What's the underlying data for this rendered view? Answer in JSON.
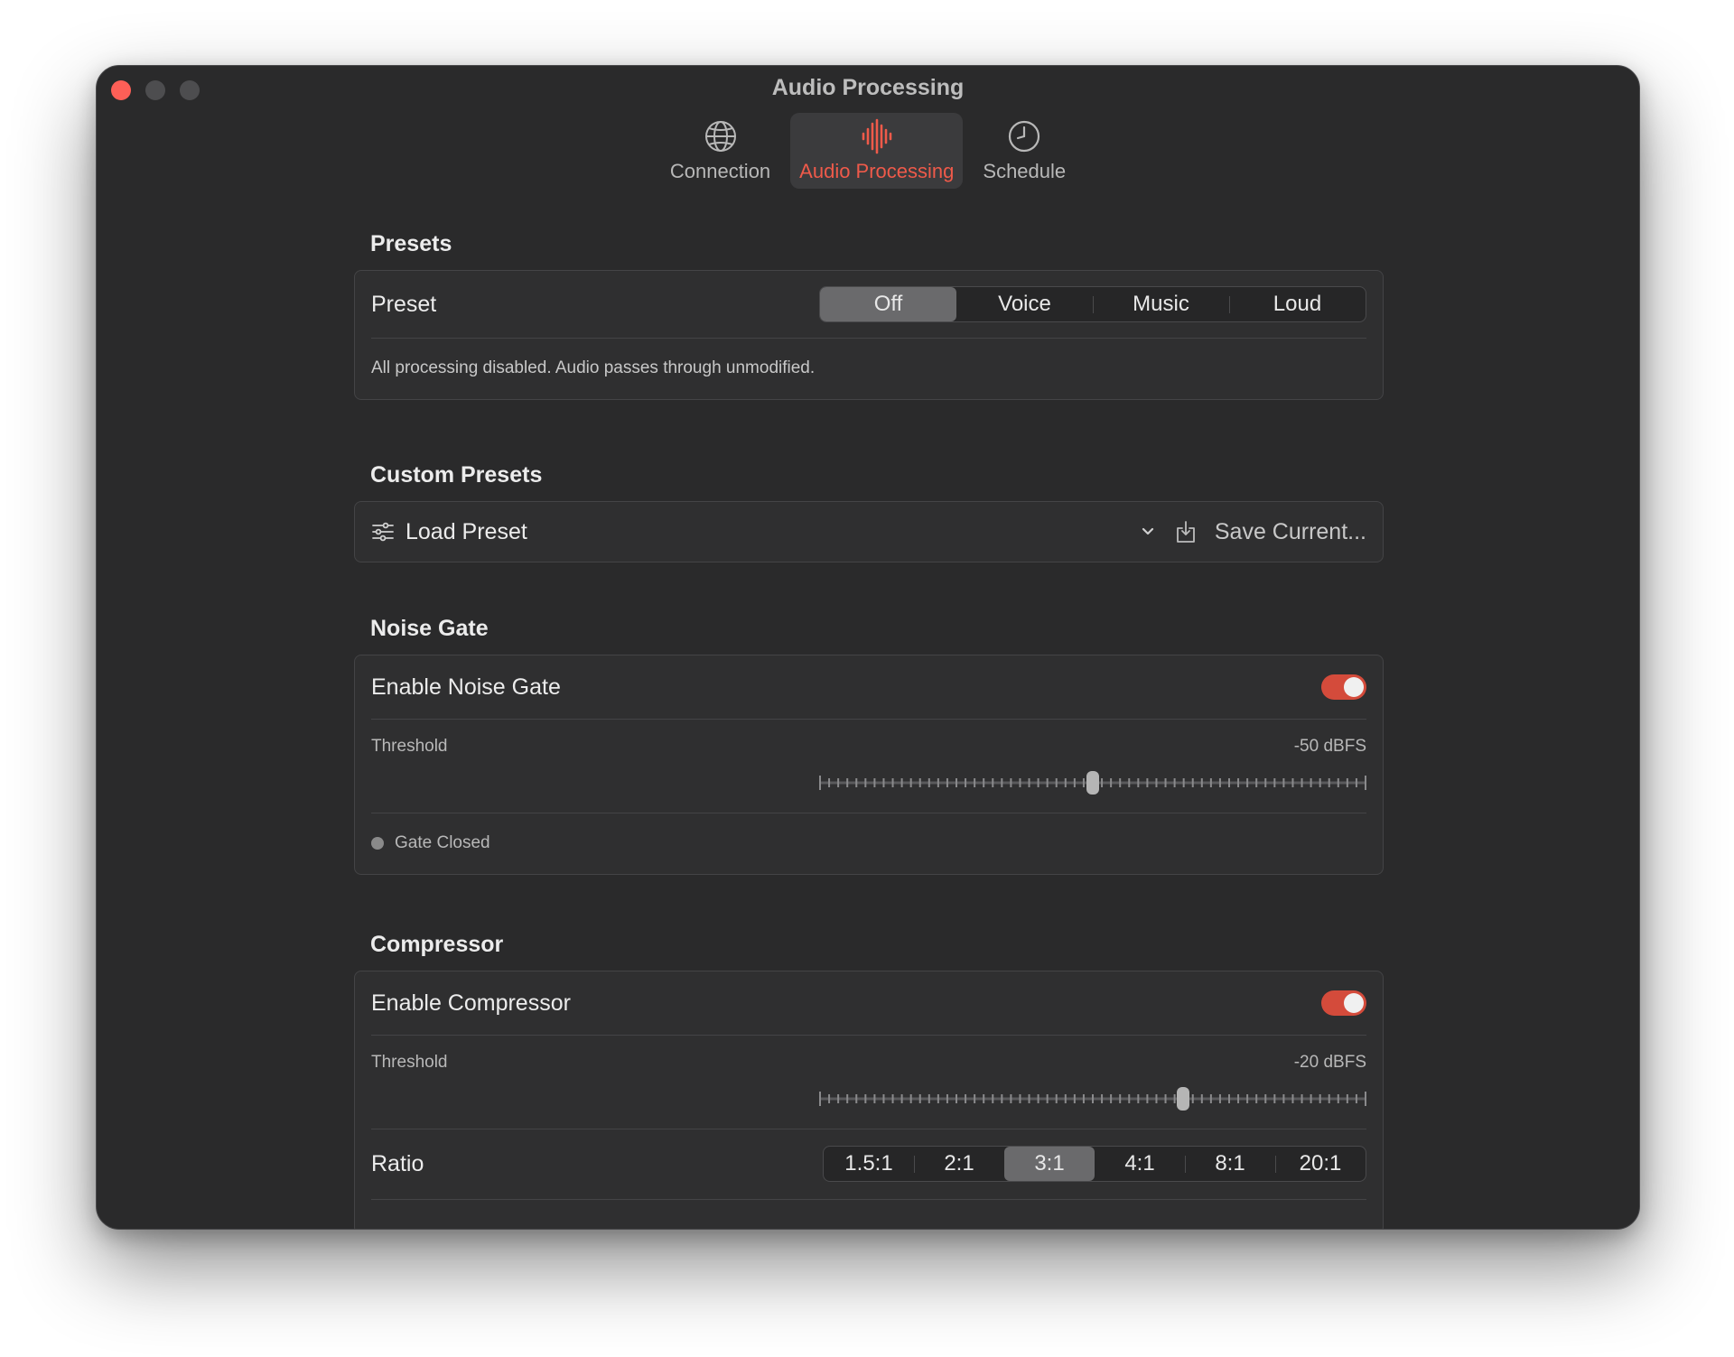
{
  "window": {
    "title": "Audio Processing"
  },
  "toolbar": {
    "tabs": [
      {
        "label": "Connection",
        "icon": "globe-icon",
        "active": false
      },
      {
        "label": "Audio Processing",
        "icon": "waveform-icon",
        "active": true
      },
      {
        "label": "Schedule",
        "icon": "clock-icon",
        "active": false
      }
    ]
  },
  "colors": {
    "accent": "#ef5a4a",
    "toggle_on": "#d44b3b",
    "window_bg": "#2a2a2b"
  },
  "presets": {
    "section_title": "Presets",
    "row_label": "Preset",
    "options": [
      "Off",
      "Voice",
      "Music",
      "Loud"
    ],
    "selected": "Off",
    "description": "All processing disabled. Audio passes through unmodified."
  },
  "custom_presets": {
    "section_title": "Custom Presets",
    "load_label": "Load Preset",
    "save_label": "Save Current..."
  },
  "noise_gate": {
    "section_title": "Noise Gate",
    "enable_label": "Enable Noise Gate",
    "enabled": true,
    "threshold_label": "Threshold",
    "threshold_value": "-50 dBFS",
    "threshold_fraction": 0.5,
    "status": "Gate Closed"
  },
  "compressor": {
    "section_title": "Compressor",
    "enable_label": "Enable Compressor",
    "enabled": true,
    "threshold_label": "Threshold",
    "threshold_value": "-20 dBFS",
    "threshold_fraction": 0.665,
    "ratio_label": "Ratio",
    "ratio_options": [
      "1.5:1",
      "2:1",
      "3:1",
      "4:1",
      "8:1",
      "20:1"
    ],
    "ratio_selected": "3:1"
  }
}
